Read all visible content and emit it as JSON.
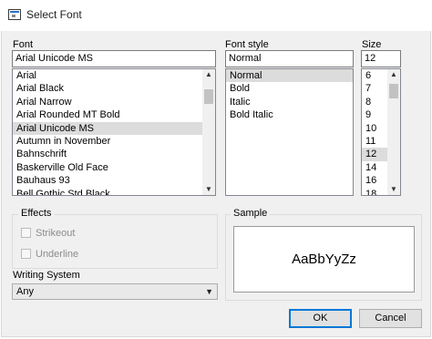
{
  "window": {
    "title": "Select Font"
  },
  "font": {
    "label": "Font",
    "value": "Arial Unicode MS",
    "items": [
      "Arial",
      "Arial Black",
      "Arial Narrow",
      "Arial Rounded MT Bold",
      "Arial Unicode MS",
      "Autumn in November",
      "Bahnschrift",
      "Baskerville Old Face",
      "Bauhaus 93",
      "Bell Gothic Std Black"
    ],
    "selected": "Arial Unicode MS"
  },
  "style": {
    "label": "Font style",
    "value": "Normal",
    "items": [
      "Normal",
      "Bold",
      "Italic",
      "Bold Italic"
    ],
    "selected": "Normal"
  },
  "size": {
    "label": "Size",
    "value": "12",
    "items": [
      "6",
      "7",
      "8",
      "9",
      "10",
      "11",
      "12",
      "14",
      "16",
      "18"
    ],
    "selected": "12"
  },
  "effects": {
    "title": "Effects",
    "strikeout": "Strikeout",
    "underline": "Underline"
  },
  "sample": {
    "title": "Sample",
    "text": "AaBbYyZz"
  },
  "writing_system": {
    "label": "Writing System",
    "value": "Any"
  },
  "buttons": {
    "ok": "OK",
    "cancel": "Cancel"
  },
  "icons": {
    "app": "font-dialog-icon",
    "scroll_up": "scroll-up-arrow-icon",
    "scroll_down": "scroll-down-arrow-icon",
    "dropdown": "chevron-down-icon"
  },
  "colors": {
    "selection": "#dcdcdc",
    "dialog_bg": "#f0f0f0",
    "default_button_border": "#0078d7"
  }
}
